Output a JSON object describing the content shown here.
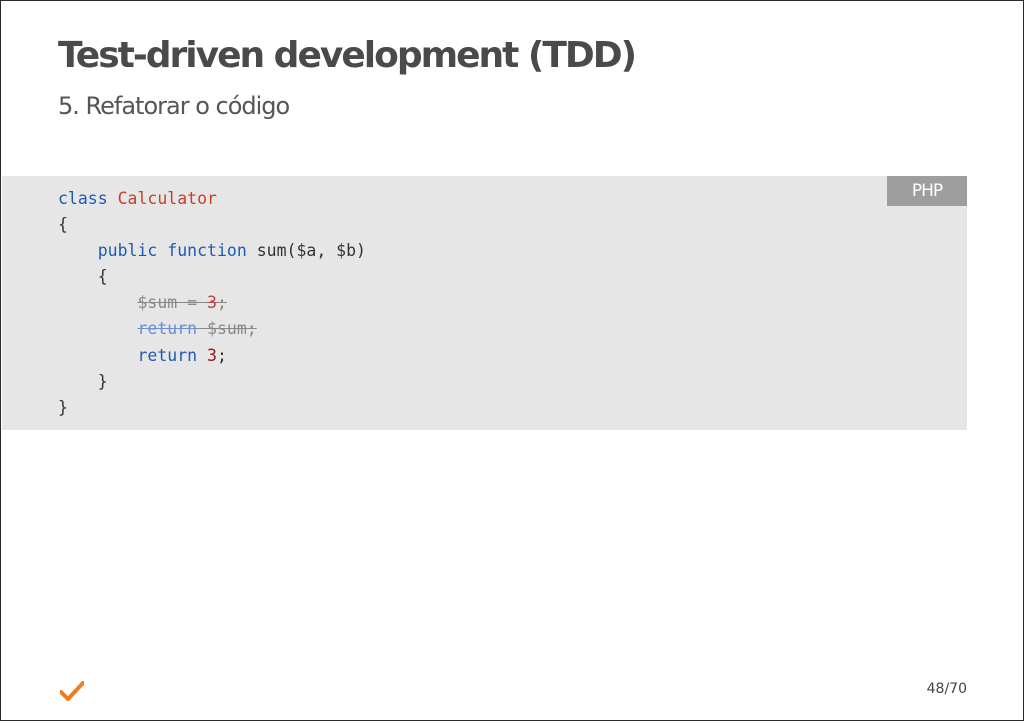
{
  "slide": {
    "title": "Test-driven development (TDD)",
    "subtitle": "5. Refatorar o código",
    "page_number": "48/70"
  },
  "code": {
    "language": "PHP",
    "lines": [
      {
        "indent": "",
        "tokens": [
          {
            "text": "class",
            "type": "kw"
          },
          {
            "text": " ",
            "type": "plain"
          },
          {
            "text": "Calculator",
            "type": "cls"
          }
        ]
      },
      {
        "indent": "",
        "tokens": [
          {
            "text": "{",
            "type": "plain"
          }
        ]
      },
      {
        "indent": "    ",
        "tokens": [
          {
            "text": "public",
            "type": "kw"
          },
          {
            "text": " ",
            "type": "plain"
          },
          {
            "text": "function",
            "type": "kw"
          },
          {
            "text": " sum($a, $b)",
            "type": "plain"
          }
        ]
      },
      {
        "indent": "    ",
        "tokens": [
          {
            "text": "{",
            "type": "plain"
          }
        ]
      },
      {
        "indent": "        ",
        "tokens": [
          {
            "text": "$sum = ",
            "type": "plain",
            "strike": true
          },
          {
            "text": "3",
            "type": "num",
            "strike": true
          },
          {
            "text": ";",
            "type": "plain",
            "strike": true
          }
        ]
      },
      {
        "indent": "        ",
        "tokens": [
          {
            "text": "return",
            "type": "kw",
            "strike": true
          },
          {
            "text": " $sum;",
            "type": "plain",
            "strike": true
          }
        ]
      },
      {
        "indent": "        ",
        "tokens": [
          {
            "text": "return",
            "type": "kw"
          },
          {
            "text": " ",
            "type": "plain"
          },
          {
            "text": "3",
            "type": "num"
          },
          {
            "text": ";",
            "type": "plain"
          }
        ]
      },
      {
        "indent": "    ",
        "tokens": [
          {
            "text": "}",
            "type": "plain"
          }
        ]
      },
      {
        "indent": "",
        "tokens": [
          {
            "text": "}",
            "type": "plain"
          }
        ]
      }
    ]
  },
  "footer": {
    "logo_icon": "checkmark-icon",
    "logo_color": "#f07c1c"
  },
  "colors": {
    "title": "#4a4a4a",
    "code_background": "#e6e6e6",
    "badge_background": "#9e9e9e",
    "keyword": "#1d5ab8",
    "class_name": "#c8402a",
    "number": "#a01515"
  }
}
